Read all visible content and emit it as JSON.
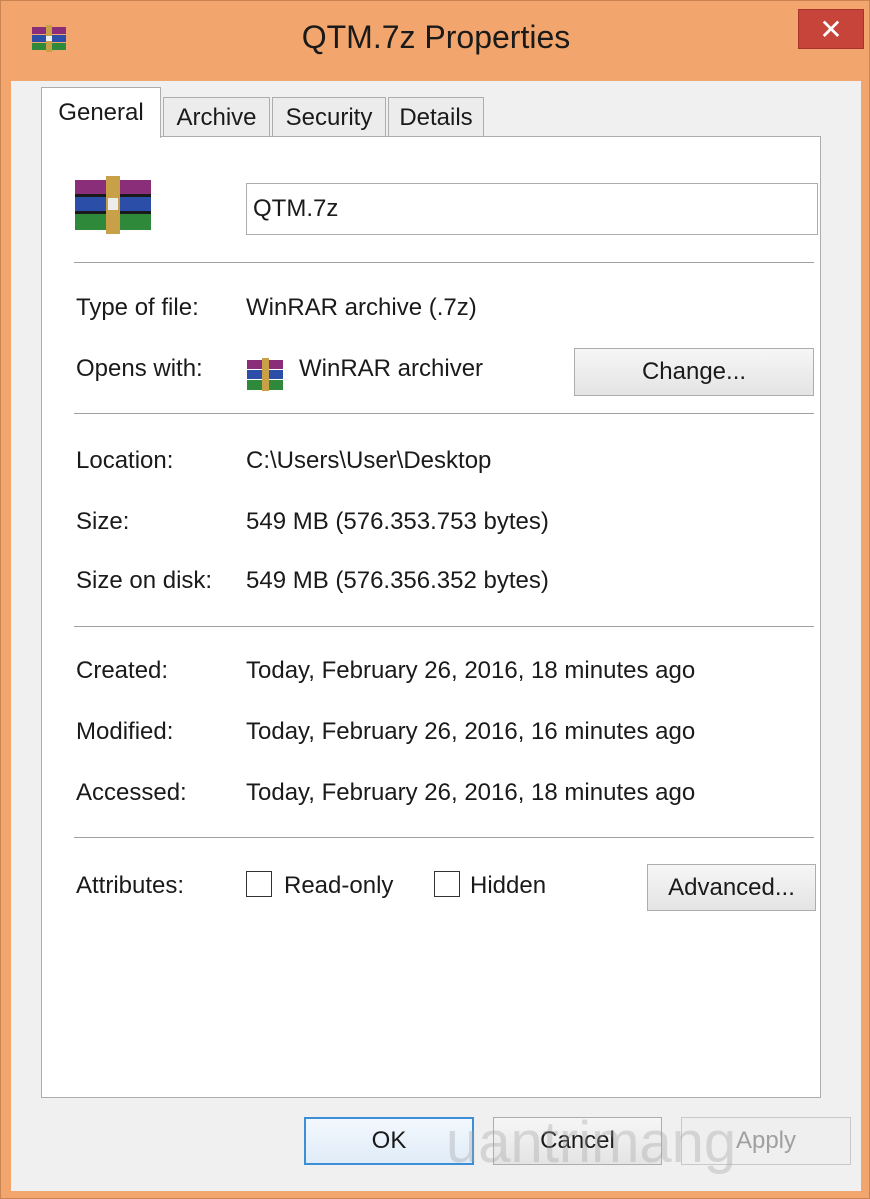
{
  "window": {
    "title": "QTM.7z Properties",
    "close_glyph": "✕"
  },
  "tabs": [
    {
      "label": "General",
      "active": true
    },
    {
      "label": "Archive",
      "active": false
    },
    {
      "label": "Security",
      "active": false
    },
    {
      "label": "Details",
      "active": false
    }
  ],
  "general": {
    "file_name": "QTM.7z",
    "type_label": "Type of file:",
    "type_value": "WinRAR archive (.7z)",
    "opens_label": "Opens with:",
    "opens_value": "WinRAR archiver",
    "change_button": "Change...",
    "location_label": "Location:",
    "location_value": "C:\\Users\\User\\Desktop",
    "size_label": "Size:",
    "size_value": "549 MB (576.353.753 bytes)",
    "size_disk_label": "Size on disk:",
    "size_disk_value": "549 MB (576.356.352 bytes)",
    "created_label": "Created:",
    "created_value": "Today, February 26, 2016, 18 minutes ago",
    "modified_label": "Modified:",
    "modified_value": "Today, February 26, 2016, 16 minutes ago",
    "accessed_label": "Accessed:",
    "accessed_value": "Today, February 26, 2016, 18 minutes ago",
    "attributes_label": "Attributes:",
    "readonly_label": "Read-only",
    "readonly_checked": false,
    "hidden_label": "Hidden",
    "hidden_checked": false,
    "advanced_button": "Advanced..."
  },
  "footer": {
    "ok": "OK",
    "cancel": "Cancel",
    "apply": "Apply",
    "apply_enabled": false
  },
  "watermark": "uantrimang",
  "icons": {
    "app": "winrar-archive-icon",
    "opens_with": "winrar-archiver-icon",
    "close": "close-icon"
  },
  "colors": {
    "frame": "#f2a56c",
    "close": "#c7443a",
    "ok_border": "#3c8fd6",
    "panel": "#ffffff"
  }
}
